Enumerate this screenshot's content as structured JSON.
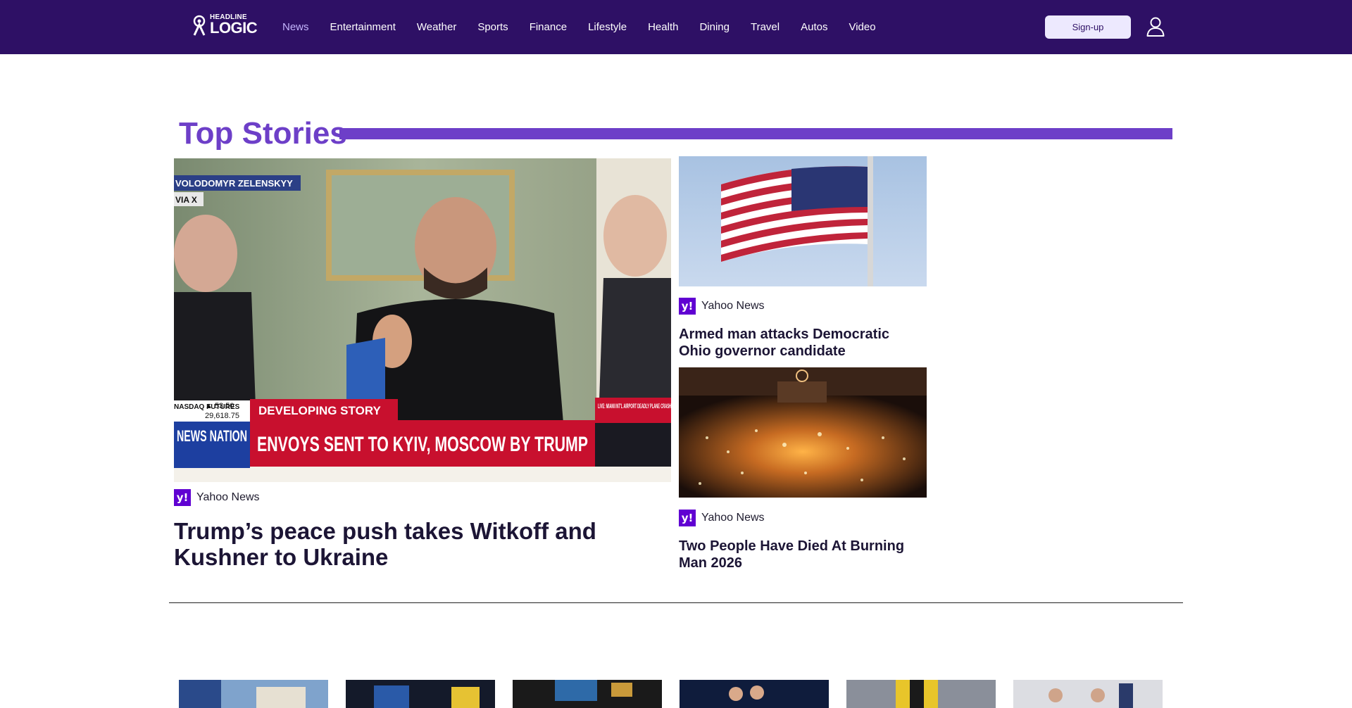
{
  "brand": {
    "line1": "HEADLINE",
    "line2": "LOGIC"
  },
  "nav": {
    "items": [
      {
        "label": "News",
        "active": true
      },
      {
        "label": "Entertainment"
      },
      {
        "label": "Weather"
      },
      {
        "label": "Sports"
      },
      {
        "label": "Finance"
      },
      {
        "label": "Lifestyle"
      },
      {
        "label": "Health"
      },
      {
        "label": "Dining"
      },
      {
        "label": "Travel"
      },
      {
        "label": "Autos"
      },
      {
        "label": "Video"
      }
    ]
  },
  "header": {
    "signup_label": "Sign-up",
    "user_icon": "user-icon"
  },
  "top_stories": {
    "title": "Top Stories",
    "main": {
      "source": "Yahoo News",
      "headline": "Trump’s peace push takes Witkoff and Kushner to Ukraine",
      "image_text": {
        "name_tag": "VOLODOMYR ZELENSKYY",
        "via_tag": "VIA X",
        "ticker_label": "NASDAQ FUTURES",
        "ticker_change": "▲ 53.50",
        "ticker_value": "29,618.75",
        "developing": "DEVELOPING STORY",
        "banner": "ENVOYS SENT TO KYIV, MOSCOW BY TRUMP",
        "network": "NEWS NATION",
        "live": "LIVE: MIAMI INT'L AIRPORT DEADLY PLANE CRASH"
      }
    },
    "side": [
      {
        "source": "Yahoo News",
        "headline": "Armed man attacks Democratic Ohio governor candidate"
      },
      {
        "source": "Yahoo News",
        "headline": "Two People Have Died At Burning Man 2026"
      }
    ]
  },
  "colors": {
    "header_bg": "#2e1065",
    "accent": "#6d3fc8",
    "nav_active": "#c4b5fd",
    "yahoo": "#6001d2"
  }
}
